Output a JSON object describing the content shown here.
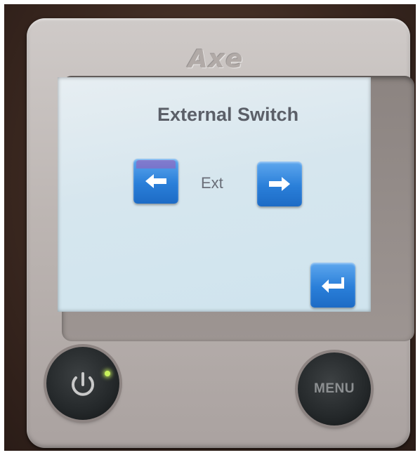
{
  "device": {
    "brand": "Axe"
  },
  "screen": {
    "title": "External Switch",
    "value": "Ext",
    "buttons": {
      "prev_icon": "arrow-left-icon",
      "next_icon": "arrow-right-icon",
      "enter_icon": "enter-return-icon"
    }
  },
  "hardware": {
    "power_icon": "power-icon",
    "menu_label": "MENU",
    "led_color": "#c8f25c"
  },
  "colors": {
    "button_blue": "#2a7fd9",
    "screen_bg": "#d6e6ee",
    "title_text": "#5b5f68"
  }
}
